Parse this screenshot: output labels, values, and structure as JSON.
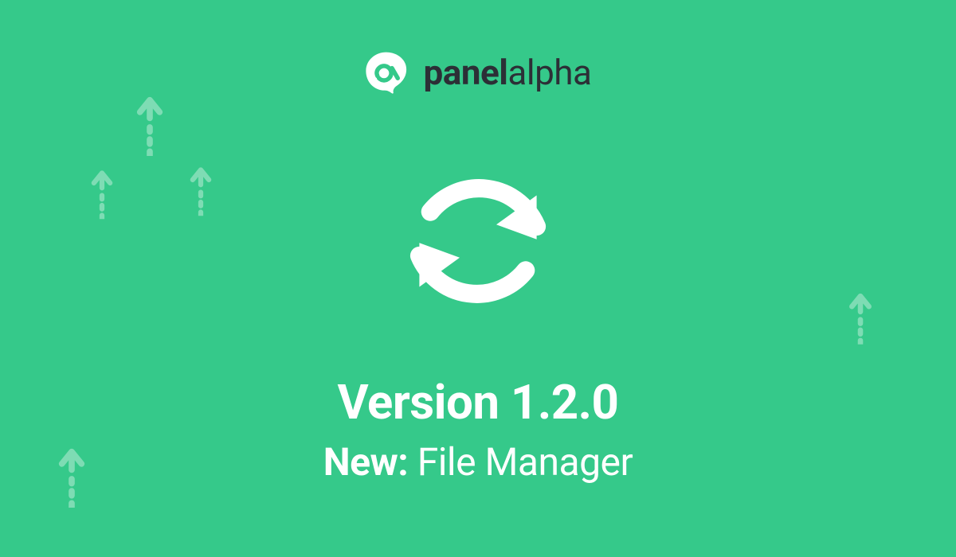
{
  "brand": {
    "name_bold": "panel",
    "name_light": "alpha"
  },
  "headline": {
    "version_prefix": "Version",
    "version_number": "1.2.0",
    "feature_lead": "New:",
    "feature_name": "File Manager"
  },
  "icons": {
    "logo": "alpha-blob-icon",
    "center": "refresh-icon",
    "decoration": "arrow-up-dashed-icon"
  },
  "palette": {
    "bg": "#35c98a",
    "fg_white": "#ffffff",
    "fg_dark": "#2c2f36",
    "deco_arrow": "#d8f5e8"
  }
}
